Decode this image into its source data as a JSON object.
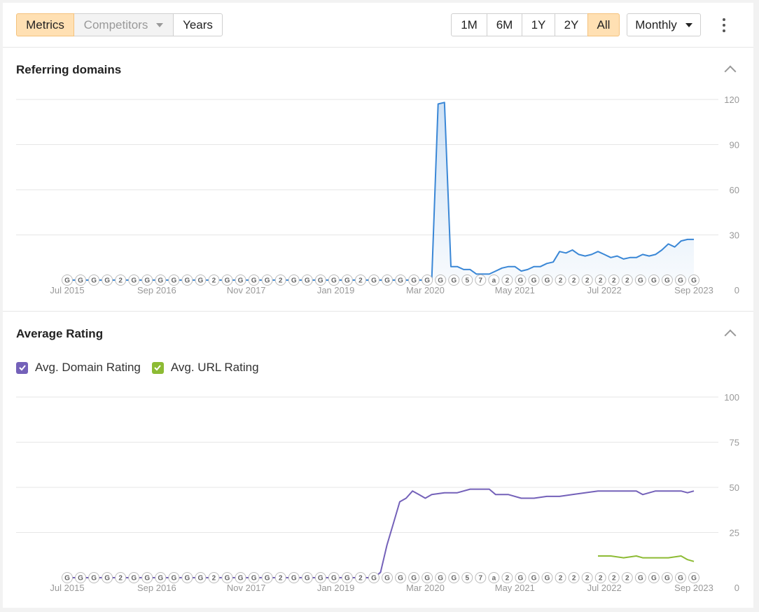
{
  "toolbar": {
    "view_tabs": [
      {
        "label": "Metrics",
        "active": true
      },
      {
        "label": "Competitors",
        "disabled": true
      },
      {
        "label": "Years"
      }
    ],
    "ranges": [
      {
        "label": "1M"
      },
      {
        "label": "6M"
      },
      {
        "label": "1Y"
      },
      {
        "label": "2Y"
      },
      {
        "label": "All",
        "active": true
      }
    ],
    "granularity": "Monthly"
  },
  "colors": {
    "accent_active": "#ffe0b3",
    "referring_line": "#3a87d6",
    "domain_rating": "#7461b9",
    "url_rating": "#8dbb34"
  },
  "x_axis_labels": [
    "Jul 2015",
    "Sep 2016",
    "Nov 2017",
    "Jan 2019",
    "Mar 2020",
    "May 2021",
    "Jul 2022",
    "Sep 2023"
  ],
  "annotation_markers": [
    "G",
    "G",
    "G",
    "G",
    "2",
    "G",
    "G",
    "G",
    "G",
    "G",
    "G",
    "2",
    "G",
    "G",
    "G",
    "G",
    "2",
    "G",
    "G",
    "G",
    "G",
    "G",
    "2",
    "G",
    "G",
    "G",
    "G",
    "G",
    "G",
    "G",
    "5",
    "7",
    "a",
    "2",
    "G",
    "G",
    "G",
    "2",
    "2",
    "2",
    "2",
    "2",
    "2",
    "G",
    "G",
    "G",
    "G",
    "G"
  ],
  "chart_data": [
    {
      "type": "area",
      "title": "Referring domains",
      "x": [
        "2015-07",
        "2015-10",
        "2016-01",
        "2016-04",
        "2016-07",
        "2016-10",
        "2017-01",
        "2017-04",
        "2017-07",
        "2017-10",
        "2018-01",
        "2018-04",
        "2018-07",
        "2018-10",
        "2019-01",
        "2019-04",
        "2019-07",
        "2019-10",
        "2020-01",
        "2020-03",
        "2020-04",
        "2020-05",
        "2020-06",
        "2020-07",
        "2020-08",
        "2020-09",
        "2020-10",
        "2020-11",
        "2020-12",
        "2021-01",
        "2021-02",
        "2021-03",
        "2021-04",
        "2021-05",
        "2021-06",
        "2021-07",
        "2021-08",
        "2021-09",
        "2021-10",
        "2021-11",
        "2021-12",
        "2022-01",
        "2022-02",
        "2022-03",
        "2022-04",
        "2022-05",
        "2022-06",
        "2022-07",
        "2022-08",
        "2022-09",
        "2022-10",
        "2022-11",
        "2022-12",
        "2023-01",
        "2023-02",
        "2023-03",
        "2023-04",
        "2023-05",
        "2023-06",
        "2023-07",
        "2023-08",
        "2023-09"
      ],
      "series": [
        {
          "values": [
            0,
            0,
            0,
            0,
            0,
            0,
            0,
            0,
            0,
            0,
            0,
            0,
            0,
            0,
            0,
            0,
            0,
            0,
            0,
            0,
            0,
            117,
            118,
            9,
            9,
            7,
            7,
            4,
            4,
            4,
            6,
            8,
            9,
            9,
            6,
            7,
            9,
            9,
            11,
            12,
            19,
            18,
            20,
            17,
            16,
            17,
            19,
            17,
            15,
            16,
            14,
            15,
            15,
            17,
            16,
            17,
            20,
            24,
            22,
            26,
            27,
            27
          ]
        }
      ],
      "ylim": [
        0,
        120
      ],
      "yticks": [
        0,
        30,
        60,
        90,
        120
      ]
    },
    {
      "type": "line",
      "title": "Average Rating",
      "x": [
        "2015-07",
        "2016-01",
        "2016-07",
        "2017-01",
        "2017-07",
        "2018-01",
        "2018-07",
        "2019-01",
        "2019-04",
        "2019-07",
        "2019-08",
        "2019-09",
        "2019-10",
        "2019-11",
        "2019-12",
        "2020-01",
        "2020-02",
        "2020-03",
        "2020-04",
        "2020-06",
        "2020-08",
        "2020-10",
        "2020-12",
        "2021-01",
        "2021-02",
        "2021-04",
        "2021-06",
        "2021-08",
        "2021-10",
        "2021-12",
        "2022-02",
        "2022-04",
        "2022-06",
        "2022-08",
        "2022-10",
        "2022-12",
        "2023-01",
        "2023-03",
        "2023-05",
        "2023-07",
        "2023-08",
        "2023-09"
      ],
      "series": [
        {
          "name": "Avg. Domain Rating",
          "values": [
            0,
            0,
            0,
            0,
            0,
            0,
            0,
            0,
            0,
            0,
            3,
            18,
            30,
            42,
            44,
            48,
            46,
            44,
            46,
            47,
            47,
            49,
            49,
            49,
            46,
            46,
            44,
            44,
            45,
            45,
            46,
            47,
            48,
            48,
            48,
            48,
            46,
            48,
            48,
            48,
            47,
            48
          ]
        },
        {
          "name": "Avg. URL Rating",
          "x": [
            "2022-06",
            "2022-08",
            "2022-10",
            "2022-12",
            "2023-01",
            "2023-03",
            "2023-05",
            "2023-07",
            "2023-08",
            "2023-09"
          ],
          "values": [
            12,
            12,
            11,
            12,
            11,
            11,
            11,
            12,
            10,
            9
          ]
        }
      ],
      "ylim": [
        0,
        100
      ],
      "yticks": [
        0,
        25,
        50,
        75,
        100
      ]
    }
  ]
}
